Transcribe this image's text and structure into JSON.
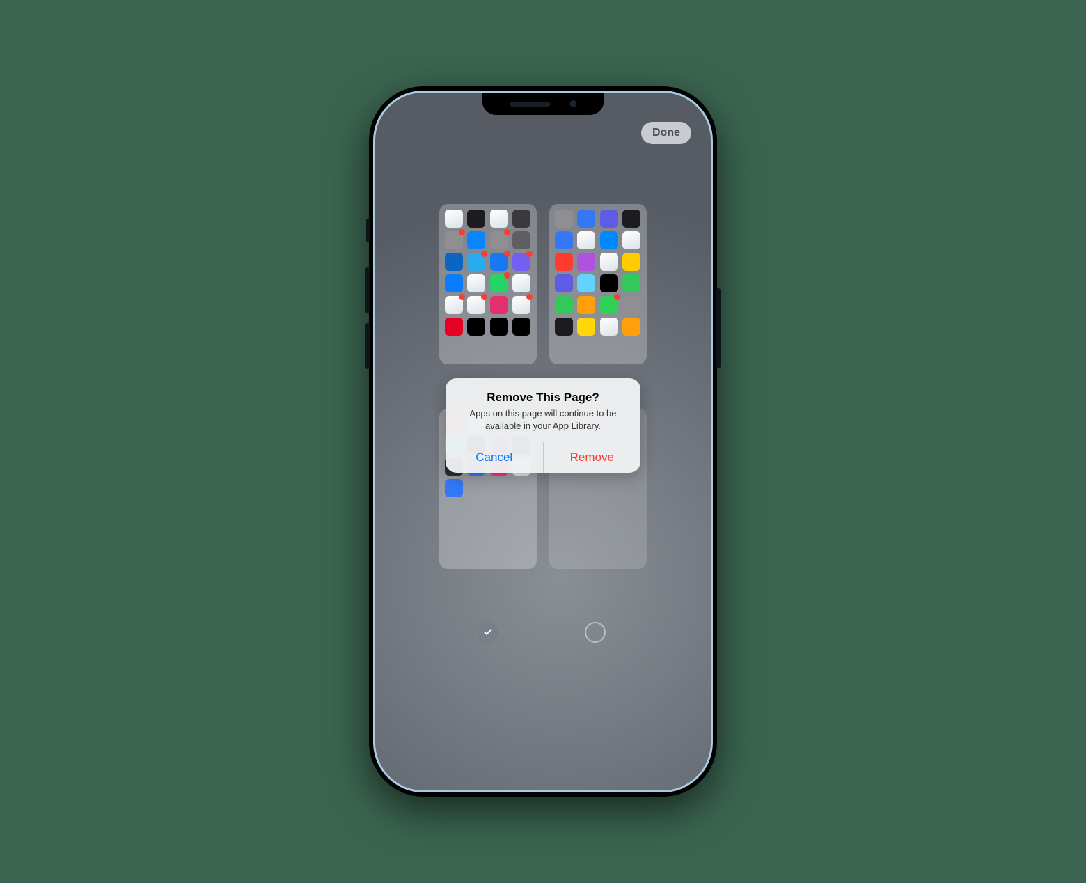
{
  "done_label": "Done",
  "alert": {
    "title": "Remove This Page?",
    "message": "Apps on this page will continue to be available in your App Library.",
    "cancel": "Cancel",
    "remove": "Remove"
  },
  "pages": [
    {
      "selected": true,
      "apps": [
        {
          "name": "calendar",
          "color": "#ffffff",
          "badge": false
        },
        {
          "name": "clock",
          "color": "#1c1c1e",
          "badge": false
        },
        {
          "name": "photos",
          "color": "#ffffff",
          "badge": false
        },
        {
          "name": "camera",
          "color": "#3a3a3c",
          "badge": false
        },
        {
          "name": "contacts",
          "color": "#8e8e93",
          "badge": true
        },
        {
          "name": "appstore",
          "color": "#0a84ff",
          "badge": false
        },
        {
          "name": "settings",
          "color": "#8e8e93",
          "badge": true
        },
        {
          "name": "screentime",
          "color": "#5f5f63",
          "badge": false
        },
        {
          "name": "linkedin",
          "color": "#0a66c2",
          "badge": false
        },
        {
          "name": "telegram",
          "color": "#2aabee",
          "badge": true
        },
        {
          "name": "facebook",
          "color": "#1877f2",
          "badge": true
        },
        {
          "name": "viber",
          "color": "#7360f2",
          "badge": true
        },
        {
          "name": "messenger",
          "color": "#0a7cff",
          "badge": false
        },
        {
          "name": "drive",
          "color": "#ffffff",
          "badge": false
        },
        {
          "name": "whatsapp",
          "color": "#25d366",
          "badge": true
        },
        {
          "name": "googlemaps",
          "color": "#ffffff",
          "badge": false
        },
        {
          "name": "gmail",
          "color": "#ffffff",
          "badge": true
        },
        {
          "name": "slack",
          "color": "#ffffff",
          "badge": true
        },
        {
          "name": "instagram",
          "color": "#e1306c",
          "badge": false
        },
        {
          "name": "youtube",
          "color": "#ffffff",
          "badge": true
        },
        {
          "name": "pinterest",
          "color": "#e60023",
          "badge": false
        },
        {
          "name": "mono",
          "color": "#000000",
          "badge": false
        },
        {
          "name": "uber",
          "color": "#000000",
          "badge": false
        },
        {
          "name": "diia",
          "color": "#000000",
          "badge": false
        }
      ]
    },
    {
      "selected": true,
      "apps": [
        {
          "name": "widget1",
          "color": "#8e8e93",
          "badge": false
        },
        {
          "name": "widget2",
          "color": "#3478f6",
          "badge": false
        },
        {
          "name": "widget3",
          "color": "#5e5ce6",
          "badge": false
        },
        {
          "name": "fitness",
          "color": "#1c1c1e",
          "badge": false
        },
        {
          "name": "files",
          "color": "#3478f6",
          "badge": false
        },
        {
          "name": "safari",
          "color": "#ffffff",
          "badge": false
        },
        {
          "name": "shazam",
          "color": "#0088ff",
          "badge": false
        },
        {
          "name": "health",
          "color": "#ffffff",
          "badge": false
        },
        {
          "name": "app-red",
          "color": "#ff3b30",
          "badge": false
        },
        {
          "name": "app-purple",
          "color": "#af52de",
          "badge": false
        },
        {
          "name": "app-google",
          "color": "#ffffff",
          "badge": false
        },
        {
          "name": "mcdonalds",
          "color": "#ffcc00",
          "badge": false
        },
        {
          "name": "app-indigo",
          "color": "#5e5ce6",
          "badge": false
        },
        {
          "name": "app-blue",
          "color": "#64d2ff",
          "badge": false
        },
        {
          "name": "x-twitter",
          "color": "#000000",
          "badge": false
        },
        {
          "name": "bolt",
          "color": "#34c759",
          "badge": false
        },
        {
          "name": "boltfood",
          "color": "#34c759",
          "badge": false
        },
        {
          "name": "app-orange",
          "color": "#ff9f0a",
          "badge": false
        },
        {
          "name": "app-green2",
          "color": "#30d158",
          "badge": true
        },
        {
          "name": "app-gray",
          "color": "#8e8e93",
          "badge": false
        },
        {
          "name": "app-dark",
          "color": "#1c1c1e",
          "badge": false
        },
        {
          "name": "app-yellow",
          "color": "#ffd60a",
          "badge": false
        },
        {
          "name": "app-white",
          "color": "#ffffff",
          "badge": false
        },
        {
          "name": "app-multi",
          "color": "#ff9f0a",
          "badge": false
        }
      ]
    },
    {
      "selected": true,
      "apps": [
        {
          "name": "app-a1",
          "color": "#ff6b6b",
          "badge": false
        },
        {
          "name": "google",
          "color": "#ffffff",
          "badge": false
        },
        {
          "name": "chatgpt",
          "color": "#10a37f",
          "badge": false
        },
        {
          "name": "app-in",
          "color": "#0f766e",
          "badge": false
        },
        {
          "name": "olx",
          "color": "#23e5db",
          "badge": false
        },
        {
          "name": "app-cam",
          "color": "#1c1c1e",
          "badge": false
        },
        {
          "name": "app-space",
          "color": "#5e5ce6",
          "badge": true
        },
        {
          "name": "app-24",
          "color": "#1c1c1e",
          "badge": false
        },
        {
          "name": "app-dark2",
          "color": "#2c2c2e",
          "badge": false
        },
        {
          "name": "app-blue2",
          "color": "#3478f6",
          "badge": false
        },
        {
          "name": "app-pink",
          "color": "#ff2d92",
          "badge": false
        },
        {
          "name": "chrome",
          "color": "#ffffff",
          "badge": false
        },
        {
          "name": "mail",
          "color": "#3478f6",
          "badge": false
        }
      ]
    },
    {
      "selected": false,
      "apps": []
    }
  ]
}
